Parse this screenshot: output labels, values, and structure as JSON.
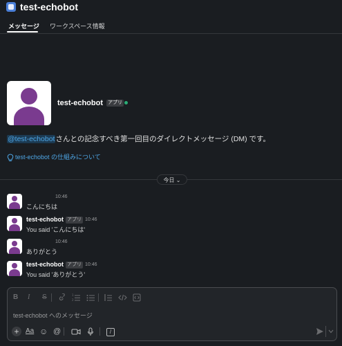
{
  "app": {
    "title": "test-echobot"
  },
  "tabs": [
    {
      "label": "メッセージ"
    },
    {
      "label": "ワークスペース情報"
    }
  ],
  "profile": {
    "name": "test-echobot",
    "badge": "アプリ"
  },
  "intro": {
    "mention": "@test-echobot",
    "text": "さんとの記念すべき第一回目のダイレクトメッセージ (DM) です。"
  },
  "howto": {
    "link": "test-echobot の仕組みについて"
  },
  "divider": {
    "label": "今日",
    "chevron": "⌄"
  },
  "messages": [
    {
      "sender": "",
      "badge": "",
      "time": "10:46",
      "text": "こんにちは"
    },
    {
      "sender": "test-echobot",
      "badge": "アプリ",
      "time": "10:46",
      "text": "You said 'こんにちは'"
    },
    {
      "sender": "",
      "badge": "",
      "time": "10:46",
      "text": "ありがとう"
    },
    {
      "sender": "test-echobot",
      "badge": "アプリ",
      "time": "10:46",
      "text": "You said 'ありがとう'"
    }
  ],
  "composer": {
    "placeholder": "test-echobot へのメッセージ",
    "format_tools": [
      "B",
      "I",
      "S",
      "link",
      "ordered-list",
      "bulleted-list",
      "blockquote",
      "code",
      "code-block"
    ],
    "bottom_tools": {
      "plus": "+",
      "aa": "Aa",
      "emoji": "☺",
      "at": "@",
      "video": "video",
      "mic": "mic",
      "slash": "/"
    }
  },
  "colors": {
    "accent_link": "#4fa8e8",
    "online": "#2bac76",
    "avatar": "#7a3b8f"
  }
}
